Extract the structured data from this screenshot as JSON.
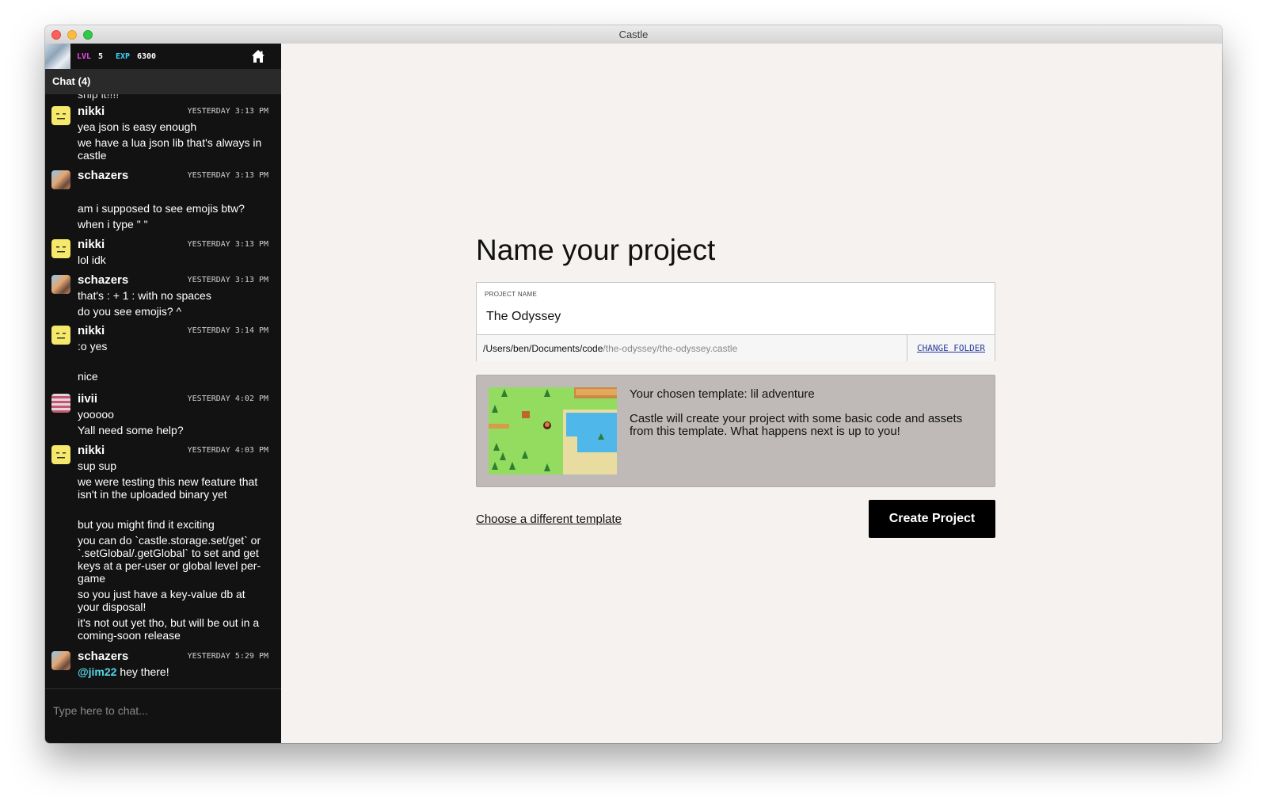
{
  "window": {
    "title": "Castle"
  },
  "sidebar": {
    "stats": {
      "lvl_label": "LVL",
      "lvl_value": "5",
      "exp_label": "EXP",
      "exp_value": "6300"
    },
    "chat_header": "Chat (4)",
    "partial_line": "ship it!!!!",
    "messages": [
      {
        "author": "nikki",
        "time": "YESTERDAY 3:13 PM",
        "lines": [
          "yea json is easy enough",
          "we have a lua json lib that's always in castle"
        ]
      },
      {
        "author": "schazers",
        "time": "YESTERDAY 3:13 PM",
        "lines": [
          "am i supposed to see emojis btw?",
          "when i type \"    \""
        ]
      },
      {
        "author": "nikki",
        "time": "YESTERDAY 3:13 PM",
        "lines": [
          "lol idk"
        ]
      },
      {
        "author": "schazers",
        "time": "YESTERDAY 3:13 PM",
        "lines": [
          "that's : + 1 : with no spaces",
          "do you see emojis? ^"
        ]
      },
      {
        "author": "nikki",
        "time": "YESTERDAY 3:14 PM",
        "lines": [
          ":o yes",
          "nice"
        ]
      },
      {
        "author": "iivii",
        "time": "YESTERDAY 4:02 PM",
        "lines": [
          "yooooo",
          "Yall need some help?"
        ]
      },
      {
        "author": "nikki",
        "time": "YESTERDAY 4:03 PM",
        "lines": [
          "sup sup",
          "we were testing this new feature that isn't in the uploaded binary yet",
          "but you might find it exciting",
          "you can do `castle.storage.set/get` or `.setGlobal/.getGlobal` to set and get keys at a per-user or global level per-game",
          "so you just have a key-value db at your disposal!",
          "it's not out yet tho, but will be out in a coming-soon release"
        ]
      },
      {
        "author": "schazers",
        "time": "YESTERDAY 5:29 PM",
        "mention": "@jim22",
        "lines": [
          "hey there!"
        ]
      }
    ],
    "chat_placeholder": "Type here to chat..."
  },
  "main": {
    "heading": "Name your project",
    "field_label": "PROJECT NAME",
    "project_name": "The Odyssey",
    "path_dir": "/Users/ben/Documents/code",
    "path_file": "/the-odyssey/the-odyssey.castle",
    "change_folder": "CHANGE FOLDER",
    "template_title": "Your chosen template: lil adventure",
    "template_desc": "Castle will create your project with some basic code and assets from this template. What happens next is up to you!",
    "choose_link": "Choose a different template",
    "create_button": "Create Project"
  },
  "colors": {
    "lvl": "#e64ce6",
    "exp": "#3fd2ff",
    "sidebar_bg": "#121212",
    "main_bg": "#f5f2ef",
    "template_bg": "#bfbab8",
    "link_blue": "#2a3b9c"
  },
  "icons": {
    "home": "home-icon"
  }
}
